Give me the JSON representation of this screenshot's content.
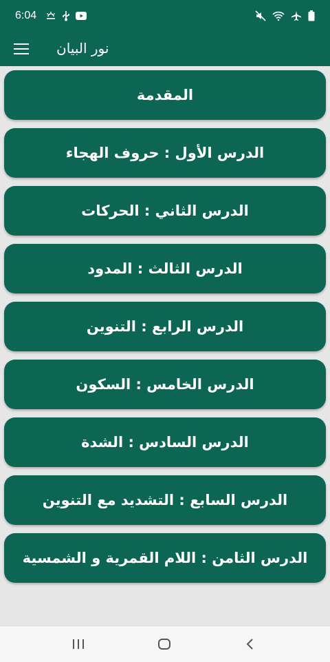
{
  "status_bar": {
    "time": "6:04",
    "left_icons": [
      "weather-icon",
      "usb-icon",
      "youtube-icon"
    ],
    "right_icons": [
      "mute-icon",
      "wifi-icon",
      "airplane-icon",
      "battery-icon"
    ]
  },
  "app_bar": {
    "title": "نور البيان",
    "menu_icon": "menu-icon"
  },
  "lessons": [
    {
      "label": "المقدمة"
    },
    {
      "label": "الدرس الأول : حروف الهجاء"
    },
    {
      "label": "الدرس الثاني : الحركات"
    },
    {
      "label": "الدرس الثالث : المدود"
    },
    {
      "label": "الدرس الرابع : التنوين"
    },
    {
      "label": "الدرس الخامس : السكون"
    },
    {
      "label": "الدرس السادس : الشدة"
    },
    {
      "label": "الدرس السابع : التشديد مع التنوين"
    },
    {
      "label": "الدرس الثامن : اللام القمرية و الشمسية"
    }
  ],
  "nav_bar": {
    "items": [
      "recents-icon",
      "home-icon",
      "back-icon"
    ]
  },
  "colors": {
    "primary": "#0d6654",
    "background": "#e6e6e6",
    "text_on_primary": "#ffffff"
  }
}
